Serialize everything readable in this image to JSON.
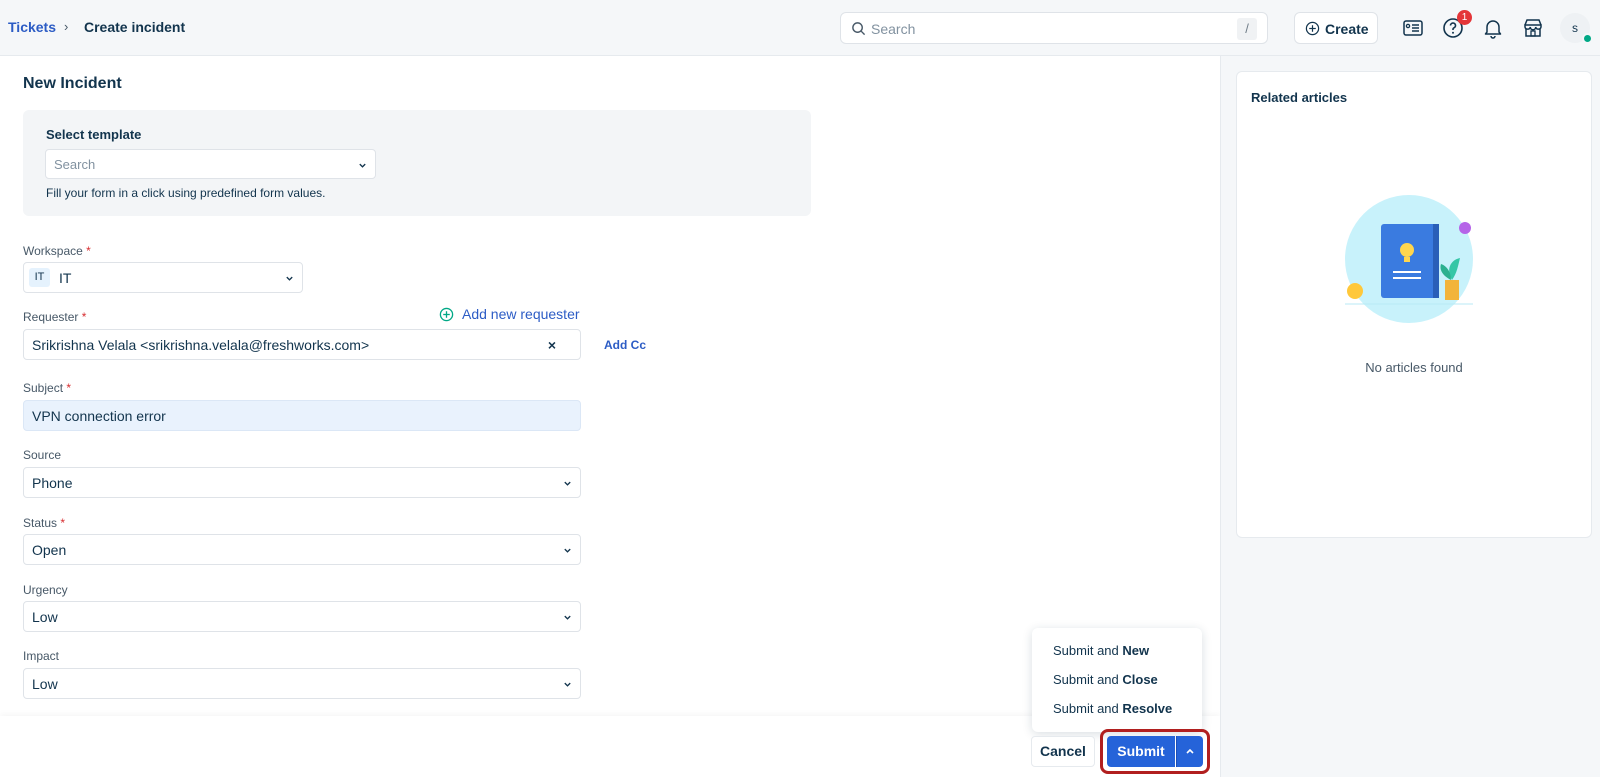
{
  "breadcrumb": {
    "root": "Tickets",
    "separator": "›",
    "current": "Create incident"
  },
  "topbar": {
    "search_placeholder": "Search",
    "search_shortcut": "/",
    "create_label": "Create",
    "help_badge_count": "1",
    "avatar_initial": "s",
    "icons": [
      "tickets-icon",
      "help-icon",
      "bell-icon",
      "store-icon"
    ]
  },
  "form": {
    "title": "New Incident",
    "template": {
      "label": "Select template",
      "placeholder": "Search",
      "help": "Fill your form in a click using predefined form values."
    },
    "workspace": {
      "label": "Workspace",
      "chip": "IT",
      "value": "IT"
    },
    "requester": {
      "label": "Requester",
      "value": "Srikrishna Velala <srikrishna.velala@freshworks.com>",
      "add_new": "Add new requester",
      "add_cc": "Add Cc"
    },
    "subject": {
      "label": "Subject",
      "value": "VPN connection error"
    },
    "source": {
      "label": "Source",
      "value": "Phone"
    },
    "status": {
      "label": "Status",
      "value": "Open"
    },
    "urgency": {
      "label": "Urgency",
      "value": "Low"
    },
    "impact": {
      "label": "Impact",
      "value": "Low"
    },
    "required_marker": "*"
  },
  "submit_menu": {
    "items": [
      {
        "prefix": "Submit and ",
        "bold": "New"
      },
      {
        "prefix": "Submit and ",
        "bold": "Close"
      },
      {
        "prefix": "Submit and ",
        "bold": "Resolve"
      }
    ]
  },
  "footer": {
    "cancel_label": "Cancel",
    "submit_label": "Submit"
  },
  "related_articles": {
    "title": "Related articles",
    "empty_text": "No articles found"
  },
  "colors": {
    "accent": "#2563d9",
    "link": "#2c5cc5",
    "required": "#d72d30",
    "highlight_outline": "#b11f1f"
  }
}
